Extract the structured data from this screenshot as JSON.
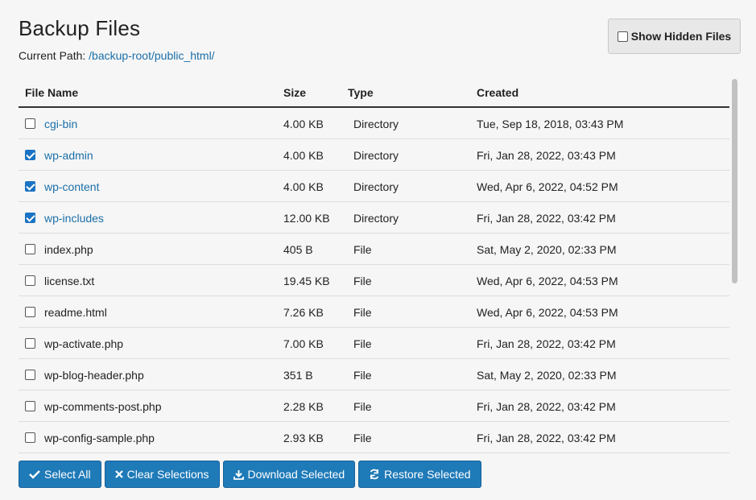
{
  "header": {
    "title": "Backup Files",
    "path_label": "Current Path:",
    "path_value": "/backup-root/public_html/"
  },
  "show_hidden": {
    "label": "Show Hidden Files",
    "checked": false
  },
  "table": {
    "columns": [
      "File Name",
      "Size",
      "Type",
      "Created"
    ],
    "rows": [
      {
        "name": "cgi-bin",
        "size": "4.00 KB",
        "type": "Directory",
        "created": "Tue, Sep 18, 2018, 03:43 PM",
        "checked": false,
        "is_dir": true
      },
      {
        "name": "wp-admin",
        "size": "4.00 KB",
        "type": "Directory",
        "created": "Fri, Jan 28, 2022, 03:43 PM",
        "checked": true,
        "is_dir": true
      },
      {
        "name": "wp-content",
        "size": "4.00 KB",
        "type": "Directory",
        "created": "Wed, Apr 6, 2022, 04:52 PM",
        "checked": true,
        "is_dir": true
      },
      {
        "name": "wp-includes",
        "size": "12.00 KB",
        "type": "Directory",
        "created": "Fri, Jan 28, 2022, 03:42 PM",
        "checked": true,
        "is_dir": true
      },
      {
        "name": "index.php",
        "size": "405 B",
        "type": "File",
        "created": "Sat, May 2, 2020, 02:33 PM",
        "checked": false,
        "is_dir": false
      },
      {
        "name": "license.txt",
        "size": "19.45 KB",
        "type": "File",
        "created": "Wed, Apr 6, 2022, 04:53 PM",
        "checked": false,
        "is_dir": false
      },
      {
        "name": "readme.html",
        "size": "7.26 KB",
        "type": "File",
        "created": "Wed, Apr 6, 2022, 04:53 PM",
        "checked": false,
        "is_dir": false
      },
      {
        "name": "wp-activate.php",
        "size": "7.00 KB",
        "type": "File",
        "created": "Fri, Jan 28, 2022, 03:42 PM",
        "checked": false,
        "is_dir": false
      },
      {
        "name": "wp-blog-header.php",
        "size": "351 B",
        "type": "File",
        "created": "Sat, May 2, 2020, 02:33 PM",
        "checked": false,
        "is_dir": false
      },
      {
        "name": "wp-comments-post.php",
        "size": "2.28 KB",
        "type": "File",
        "created": "Fri, Jan 28, 2022, 03:42 PM",
        "checked": false,
        "is_dir": false
      },
      {
        "name": "wp-config-sample.php",
        "size": "2.93 KB",
        "type": "File",
        "created": "Fri, Jan 28, 2022, 03:42 PM",
        "checked": false,
        "is_dir": false
      }
    ]
  },
  "actions": {
    "select_all": "Select All",
    "clear": "Clear Selections",
    "download": "Download Selected",
    "restore": "Restore Selected"
  },
  "icons": {
    "check": "check-icon",
    "close": "close-icon",
    "download": "download-icon",
    "restore": "refresh-icon"
  },
  "colors": {
    "link": "#1b6fa8",
    "button": "#1f7ab8",
    "checkbox": "#1a73c4"
  }
}
